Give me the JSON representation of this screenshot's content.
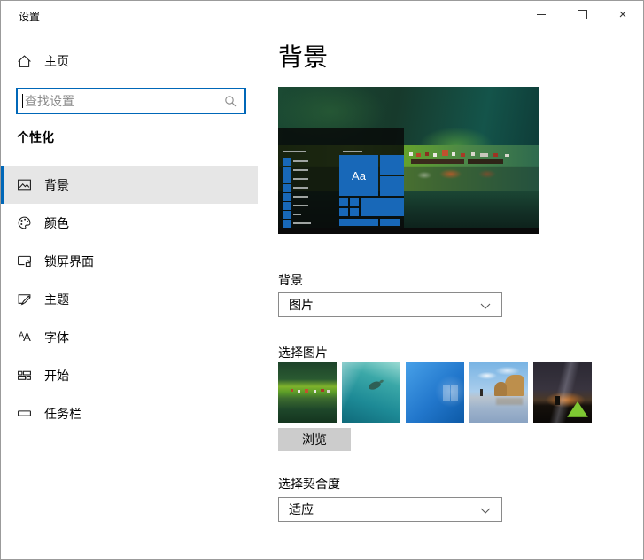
{
  "window": {
    "title": "设置",
    "controls": {
      "minimize": "最小化",
      "maximize": "最大化",
      "close": "关闭",
      "close_glyph": "×"
    }
  },
  "sidebar": {
    "home_label": "主页",
    "search": {
      "placeholder": "查找设置"
    },
    "section_header": "个性化",
    "items": [
      {
        "label": "背景",
        "icon": "image-icon",
        "selected": true
      },
      {
        "label": "颜色",
        "icon": "palette-icon",
        "selected": false
      },
      {
        "label": "锁屏界面",
        "icon": "lockscreen-icon",
        "selected": false
      },
      {
        "label": "主题",
        "icon": "theme-icon",
        "selected": false
      },
      {
        "label": "字体",
        "icon": "font-icon",
        "icon_text": "AA",
        "selected": false
      },
      {
        "label": "开始",
        "icon": "start-icon",
        "selected": false
      },
      {
        "label": "任务栏",
        "icon": "taskbar-icon",
        "selected": false
      }
    ]
  },
  "main": {
    "page_title": "背景",
    "preview": {
      "description": "fjord-wallpaper-with-start-menu-overlay",
      "tile_label": "Aa"
    },
    "background_label": "背景",
    "background_value": "图片",
    "choose_picture_label": "选择图片",
    "thumbnails": [
      {
        "name": "fjord-landscape"
      },
      {
        "name": "underwater-turtle"
      },
      {
        "name": "windows-default-blue"
      },
      {
        "name": "beach-rock-arches"
      },
      {
        "name": "night-sky-green-tent"
      }
    ],
    "browse_label": "浏览",
    "fit_label": "选择契合度",
    "fit_value": "适应"
  },
  "colors": {
    "accent": "#0067b8",
    "selected_bg": "#e6e6e6",
    "tile_blue": "#1868b8"
  }
}
